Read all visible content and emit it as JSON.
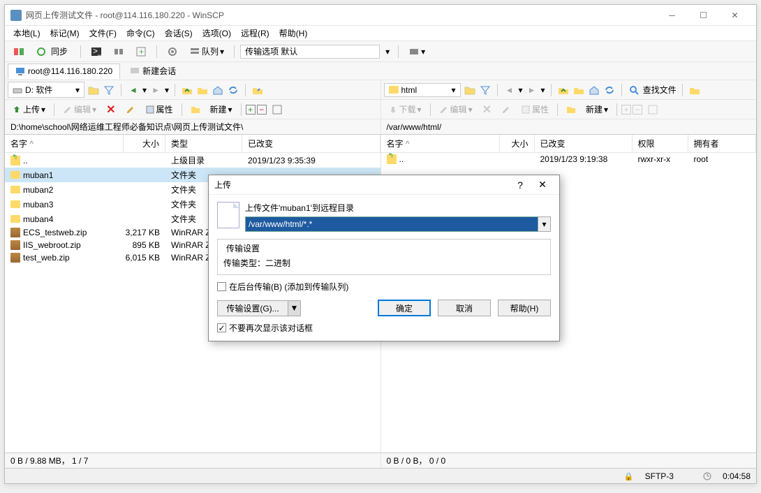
{
  "window": {
    "title": "网页上传测试文件 - root@114.116.180.220 - WinSCP"
  },
  "menu": [
    "本地(L)",
    "标记(M)",
    "文件(F)",
    "命令(C)",
    "会话(S)",
    "选项(O)",
    "远程(R)",
    "帮助(H)"
  ],
  "toolbar": {
    "sync": "同步",
    "queue": "队列",
    "transfer_opts": "传输选项 默认"
  },
  "tabs": {
    "session": "root@114.116.180.220",
    "new_session": "新建会话"
  },
  "local": {
    "drive": "D: 软件",
    "upload": "上传",
    "edit": "编辑",
    "props": "属性",
    "new": "新建",
    "path": "D:\\home\\school\\网络运维工程师必备知识点\\网页上传测试文件\\",
    "cols": {
      "name": "名字",
      "size": "大小",
      "type": "类型",
      "changed": "已改变"
    },
    "rows": [
      {
        "name": "..",
        "size": "",
        "type": "上级目录",
        "changed": "2019/1/23 9:35:39",
        "icon": "up"
      },
      {
        "name": "muban1",
        "size": "",
        "type": "文件夹",
        "changed": "",
        "icon": "folder",
        "selected": true
      },
      {
        "name": "muban2",
        "size": "",
        "type": "文件夹",
        "changed": "",
        "icon": "folder"
      },
      {
        "name": "muban3",
        "size": "",
        "type": "文件夹",
        "changed": "",
        "icon": "folder"
      },
      {
        "name": "muban4",
        "size": "",
        "type": "文件夹",
        "changed": "",
        "icon": "folder"
      },
      {
        "name": "ECS_testweb.zip",
        "size": "3,217 KB",
        "type": "WinRAR Z",
        "changed": "",
        "icon": "zip"
      },
      {
        "name": "IIS_webroot.zip",
        "size": "895 KB",
        "type": "WinRAR Z",
        "changed": "",
        "icon": "zip"
      },
      {
        "name": "test_web.zip",
        "size": "6,015 KB",
        "type": "WinRAR Z",
        "changed": "",
        "icon": "zip"
      }
    ],
    "status": "0 B / 9.88 MB， 1 / 7"
  },
  "remote": {
    "drive": "html",
    "download": "下载",
    "edit": "编辑",
    "props": "属性",
    "new": "新建",
    "find": "查找文件",
    "path": "/var/www/html/",
    "cols": {
      "name": "名字",
      "size": "大小",
      "changed": "已改变",
      "perm": "权限",
      "owner": "拥有者"
    },
    "rows": [
      {
        "name": "..",
        "size": "",
        "changed": "2019/1/23 9:19:38",
        "perm": "rwxr-xr-x",
        "owner": "root",
        "icon": "up"
      }
    ],
    "status": "0 B / 0 B， 0 / 0"
  },
  "bottom": {
    "proto": "SFTP-3",
    "time": "0:04:58"
  },
  "dialog": {
    "title": "上传",
    "label": "上传文件'muban1'到远程目录",
    "path": "/var/www/html/*.*",
    "group_title": "传输设置",
    "transfer_type": "传输类型：二进制",
    "bg_check": "在后台传输(B) (添加到传输队列)",
    "settings_btn": "传输设置(G)...",
    "ok": "确定",
    "cancel": "取消",
    "help": "帮助(H)",
    "dont_show": "不要再次显示该对话框"
  }
}
